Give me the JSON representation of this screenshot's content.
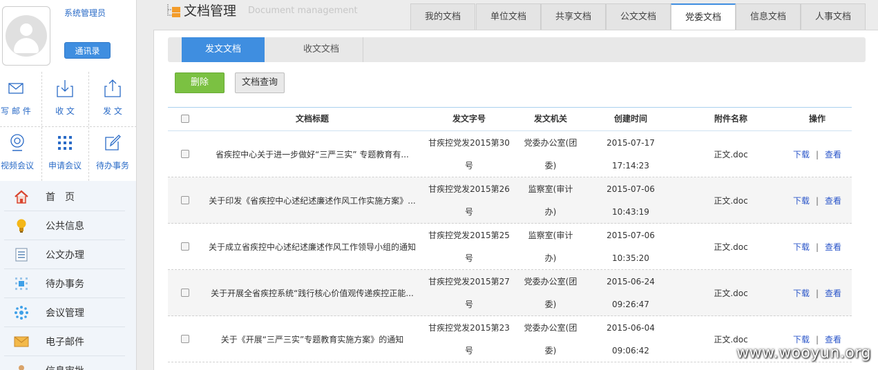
{
  "user": {
    "role": "系统管理员",
    "contacts_label": "通讯录"
  },
  "quick": [
    {
      "label": "写 邮 件",
      "icon": "envelope-icon"
    },
    {
      "label": "收  文",
      "icon": "inbox-download-icon"
    },
    {
      "label": "发  文",
      "icon": "share-upload-icon"
    },
    {
      "label": "视频会议",
      "icon": "webcam-icon"
    },
    {
      "label": "申请会议",
      "icon": "grid-icon"
    },
    {
      "label": "待办事务",
      "icon": "edit-icon"
    }
  ],
  "menu": [
    {
      "label": "首　页",
      "icon": "home-icon"
    },
    {
      "label": "公共信息",
      "icon": "lightbulb-icon"
    },
    {
      "label": "公文办理",
      "icon": "document-list-icon"
    },
    {
      "label": "待办事务",
      "icon": "task-icon"
    },
    {
      "label": "会议管理",
      "icon": "meeting-icon"
    },
    {
      "label": "电子邮件",
      "icon": "mail-icon"
    },
    {
      "label": "信息审批",
      "icon": "approval-icon"
    }
  ],
  "page": {
    "title": "文档管理",
    "subtitle": "Document management"
  },
  "tabs": [
    "我的文档",
    "单位文档",
    "共享文档",
    "公文文档",
    "党委文档",
    "信息文档",
    "人事文档"
  ],
  "active_tab": "党委文档",
  "subtabs": [
    "发文文档",
    "收文文档"
  ],
  "toolbar": {
    "delete_label": "删除",
    "query_label": "文档查询"
  },
  "columns": [
    "文档标题",
    "发文字号",
    "发文机关",
    "创建时间",
    "附件名称",
    "操作"
  ],
  "rows": [
    {
      "title": "省疾控中心关于进一步做好“三严三实” 专题教育有...",
      "num1": "甘疾控党发2015第30",
      "num2": "号",
      "org1": "党委办公室(团",
      "org2": "委)",
      "date": "2015-07-17",
      "time": "17:14:23",
      "file": "正文.doc",
      "download": "下载",
      "sep": "|",
      "view": "查看"
    },
    {
      "title": "关于印发《省疾控中心述纪述廉述作风工作实施方案》...",
      "num1": "甘疾控党发2015第26",
      "num2": "号",
      "org1": "监察室(审计",
      "org2": "办)",
      "date": "2015-07-06",
      "time": "10:43:19",
      "file": "正文.doc",
      "download": "下载",
      "sep": "|",
      "view": "查看"
    },
    {
      "title": "关于成立省疾控中心述纪述廉述作风工作领导小组的通知",
      "num1": "甘疾控党发2015第25",
      "num2": "号",
      "org1": "监察室(审计",
      "org2": "办)",
      "date": "2015-07-06",
      "time": "10:35:20",
      "file": "正文.doc",
      "download": "下载",
      "sep": "|",
      "view": "查看"
    },
    {
      "title": "关于开展全省疾控系统“践行核心价值观传递疾控正能...",
      "num1": "甘疾控党发2015第27",
      "num2": "号",
      "org1": "党委办公室(团",
      "org2": "委)",
      "date": "2015-06-24",
      "time": "09:26:47",
      "file": "正文.doc",
      "download": "下载",
      "sep": "|",
      "view": "查看"
    },
    {
      "title": "关于《开展“三严三实”专题教育实施方案》的通知",
      "num1": "甘疾控党发2015第23",
      "num2": "号",
      "org1": "党委办公室(团",
      "org2": "委)",
      "date": "2015-06-04",
      "time": "09:06:42",
      "file": "正文.doc",
      "download": "下载",
      "sep": "|",
      "view": "查看"
    }
  ],
  "watermark": "www.wooyun.org",
  "colors": {
    "accent": "#3f8ee0",
    "delete": "#7bc142",
    "link": "#2a55c9"
  }
}
